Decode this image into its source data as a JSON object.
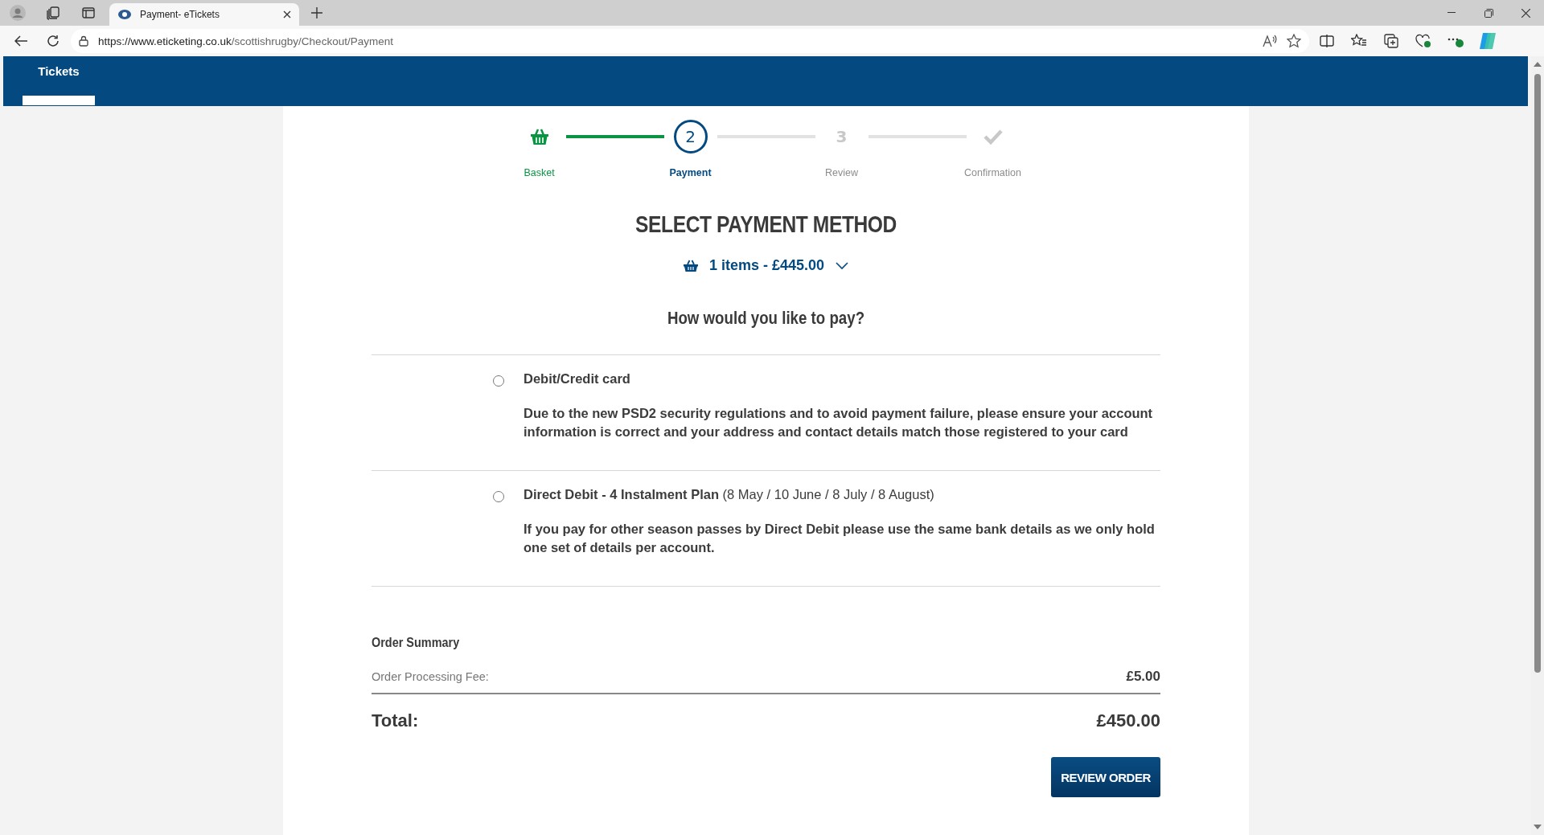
{
  "browser": {
    "tab_title": "Payment- eTickets",
    "url_host": "https://www.eticketing.co.uk",
    "url_path": "/scottishrugby/Checkout/Payment"
  },
  "nav": {
    "tabs": [
      {
        "label": "Tickets",
        "selected": true
      }
    ]
  },
  "steps": [
    {
      "kind": "basket",
      "label": "Basket",
      "completed": true,
      "selected": false
    },
    {
      "kind": "number",
      "marker": "2",
      "label": "Payment",
      "completed": false,
      "selected": true
    },
    {
      "kind": "number",
      "marker": "3",
      "label": "Review",
      "completed": false,
      "selected": false
    },
    {
      "kind": "check",
      "label": "Confirmation",
      "completed": false,
      "selected": false
    }
  ],
  "title": "SELECT PAYMENT METHOD",
  "basket_summary": "1 items - £445.00",
  "question": "How would you like to pay?",
  "payment_options": [
    {
      "title": "**Debit/Credit card**",
      "description": "Due to the new PSD2 security regulations and to avoid payment failure, please ensure your account information is correct and your address and contact details match those registered to your card",
      "selected": false
    },
    {
      "title": "**Direct Debit - 4 Instalment Plan** (8 May / 10 June / 8 July / 8 August)",
      "description": "If you pay for other season passes by Direct Debit please use the same bank details as we only hold one set of details per account.",
      "selected": false
    }
  ],
  "order_summary": {
    "heading": "Order Summary",
    "lines": [
      {
        "label": "Order Processing Fee:",
        "value": "£5.00"
      }
    ],
    "total_label": "Total:",
    "total_value": "£450.00"
  },
  "review_button": "REVIEW ORDER"
}
